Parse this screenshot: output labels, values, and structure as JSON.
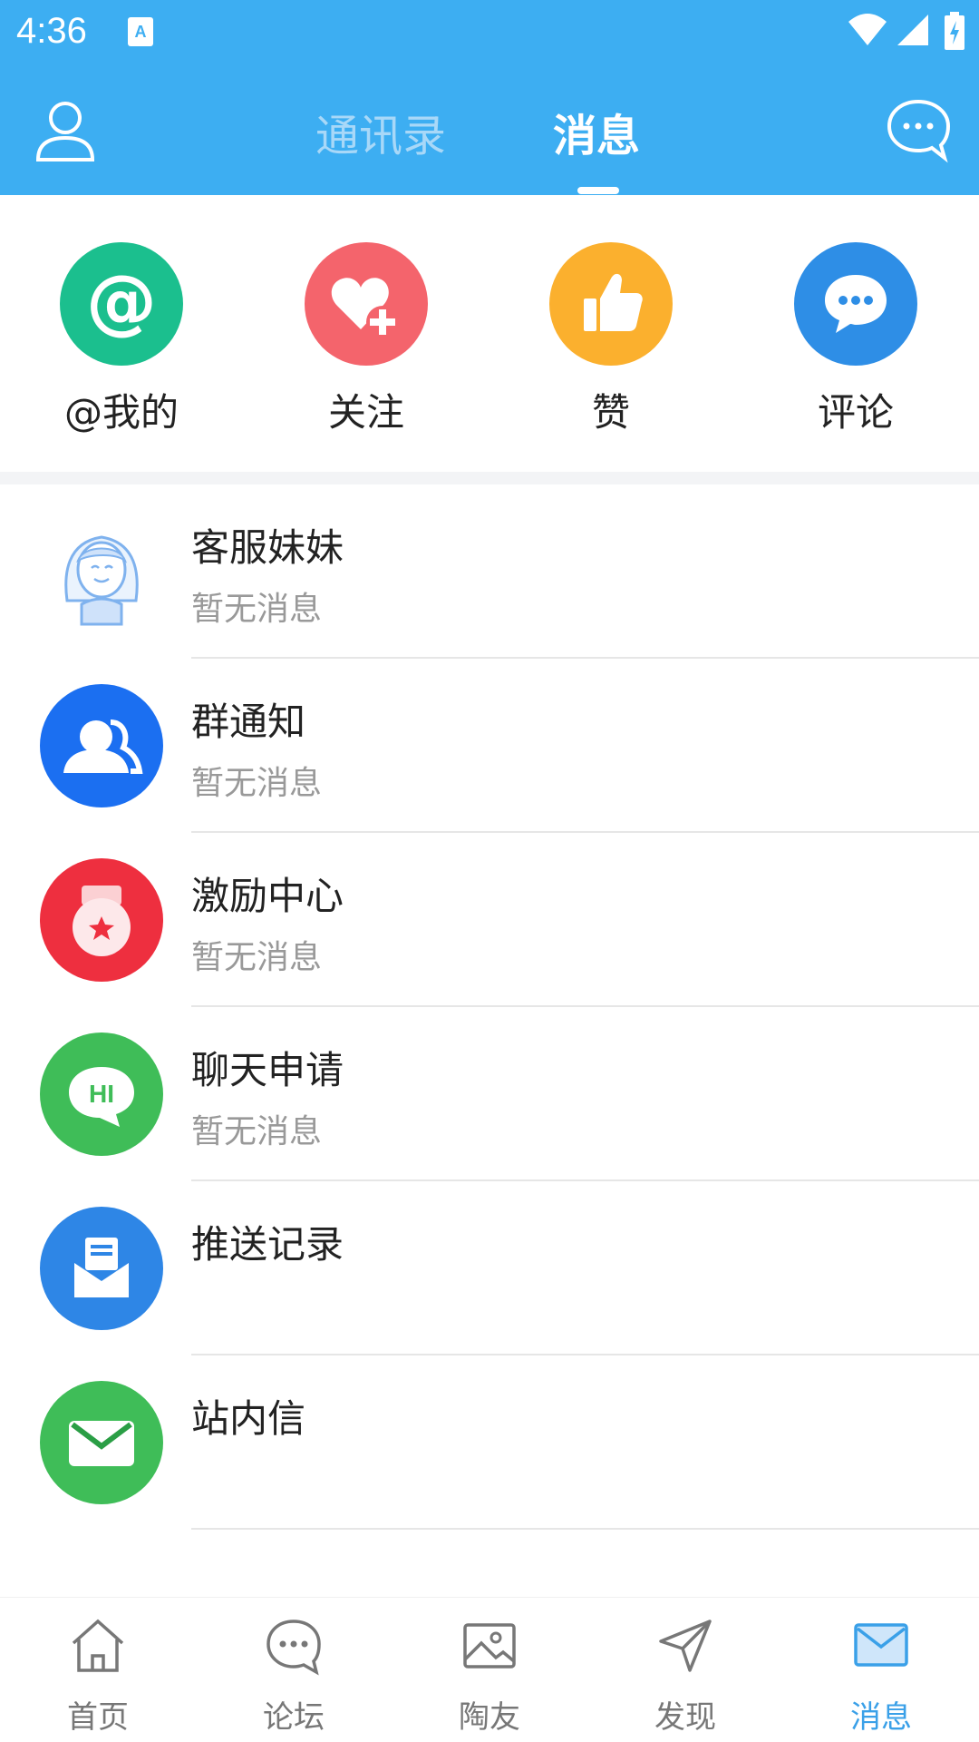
{
  "status_bar": {
    "time": "4:36"
  },
  "header": {
    "tabs": [
      {
        "label": "通讯录",
        "active": false
      },
      {
        "label": "消息",
        "active": true
      }
    ],
    "accent_color": "#3daef2"
  },
  "quick_actions": [
    {
      "label": "@我的",
      "icon": "at-icon",
      "color": "#1bbf8e"
    },
    {
      "label": "关注",
      "icon": "heart-plus-icon",
      "color": "#f4646c"
    },
    {
      "label": "赞",
      "icon": "thumbs-up-icon",
      "color": "#fbb02e"
    },
    {
      "label": "评论",
      "icon": "comment-icon",
      "color": "#2e8ee6"
    }
  ],
  "message_list": [
    {
      "title": "客服妹妹",
      "subtitle": "暂无消息",
      "icon": "support-girl-icon"
    },
    {
      "title": "群通知",
      "subtitle": "暂无消息",
      "icon": "group-icon",
      "color": "#1b6ff1"
    },
    {
      "title": "激励中心",
      "subtitle": "暂无消息",
      "icon": "medal-icon",
      "color": "#ee2f3f"
    },
    {
      "title": "聊天申请",
      "subtitle": "暂无消息",
      "icon": "hi-bubble-icon",
      "color": "#3fbd58"
    },
    {
      "title": "推送记录",
      "subtitle": "",
      "icon": "inbox-icon",
      "color": "#2e86e6"
    },
    {
      "title": "站内信",
      "subtitle": "",
      "icon": "mail-icon",
      "color": "#3fbd58"
    }
  ],
  "bottom_nav": [
    {
      "label": "首页",
      "icon": "home-icon",
      "active": false
    },
    {
      "label": "论坛",
      "icon": "forum-icon",
      "active": false
    },
    {
      "label": "陶友",
      "icon": "image-icon",
      "active": false
    },
    {
      "label": "发现",
      "icon": "send-icon",
      "active": false
    },
    {
      "label": "消息",
      "icon": "mail-outline-icon",
      "active": true
    }
  ]
}
